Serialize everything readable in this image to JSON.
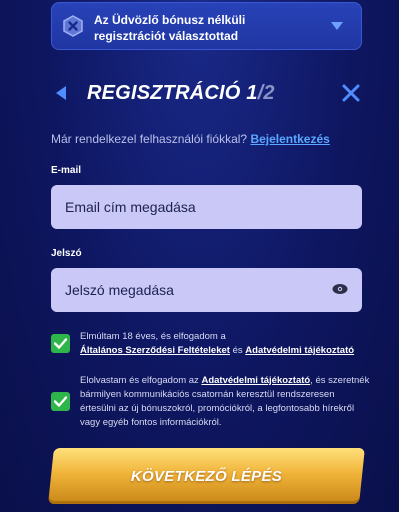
{
  "banner": {
    "text": "Az Üdvözlő bónusz nélküli regisztrációt választottad",
    "icon": "x-badge-icon"
  },
  "header": {
    "title_main": "REGISZTRÁCIÓ 1",
    "title_step": "/2"
  },
  "login_prompt": {
    "text": "Már rendelkezel felhasználói fiókkal?",
    "link": "Bejelentkezés"
  },
  "email": {
    "label": "E-mail",
    "placeholder": "Email cím megadása"
  },
  "password": {
    "label": "Jelszó",
    "placeholder": "Jelszó megadása"
  },
  "consent1": {
    "checked": true,
    "text_1": "Elmúltam 18 éves, és elfogadom a",
    "link_1": "Általános Szerződési Feltételeket",
    "text_2": "és",
    "link_2": "Adatvédelmi tájékoztató"
  },
  "consent2": {
    "checked": true,
    "text_1": "Elolvastam és elfogadom az",
    "link_1": "Adatvédelmi tájékoztató",
    "text_2": ", és szeretnék bármilyen kommunikációs csatornán keresztül rendszeresen értesülni az új bónuszokról, promóciókról, a legfontosabb hírekről vagy egyéb fontos információkról."
  },
  "next_button": {
    "label": "KÖVETKEZŐ LÉPÉS"
  },
  "colors": {
    "background": "#0e1660",
    "banner": "#2842b8",
    "field": "#c9c8f7",
    "checkbox": "#2fb64a",
    "link": "#5aa8ff",
    "button": "#f0b43a"
  }
}
